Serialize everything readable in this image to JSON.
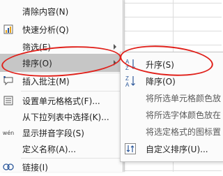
{
  "context_menu": {
    "items": [
      {
        "label": "清除内容(N)",
        "icon": "clear-icon"
      },
      {
        "label": "快速分析(Q)",
        "icon": "quick-analysis-icon"
      },
      {
        "label": "筛选(E)",
        "icon": "",
        "has_submenu": true
      },
      {
        "label": "排序(O)",
        "icon": "",
        "has_submenu": true,
        "highlighted": true
      },
      {
        "label": "插入批注(M)",
        "icon": "insert-comment-icon"
      },
      {
        "label": "设置单元格格式(F)...",
        "icon": "format-cells-icon"
      },
      {
        "label": "从下拉列表中选择(K)...",
        "icon": ""
      },
      {
        "label": "显示拼音字段(S)",
        "icon": "phonetic-icon",
        "icon_text": "wén"
      },
      {
        "label": "定义名称(A)...",
        "icon": ""
      },
      {
        "label": "链接(I)",
        "icon": "link-icon"
      }
    ]
  },
  "sort_submenu": {
    "items": [
      {
        "label": "升序(S)",
        "icon": "sort-ascending-icon",
        "icon_top": "A",
        "icon_bottom": "Z"
      },
      {
        "label": "降序(O)",
        "icon": "sort-descending-icon",
        "icon_top": "Z",
        "icon_bottom": "A"
      },
      {
        "label": "将所选单元格颜色放",
        "icon": ""
      },
      {
        "label": "将所选字体颜色放在",
        "icon": ""
      },
      {
        "label": "将选定格式的图标置",
        "icon": ""
      },
      {
        "label": "自定义排序(U)...",
        "icon": "custom-sort-icon"
      }
    ]
  },
  "colors": {
    "annotation_red": "#e0201a",
    "highlight": "#c6c6c6",
    "accent_blue": "#2b579a"
  }
}
